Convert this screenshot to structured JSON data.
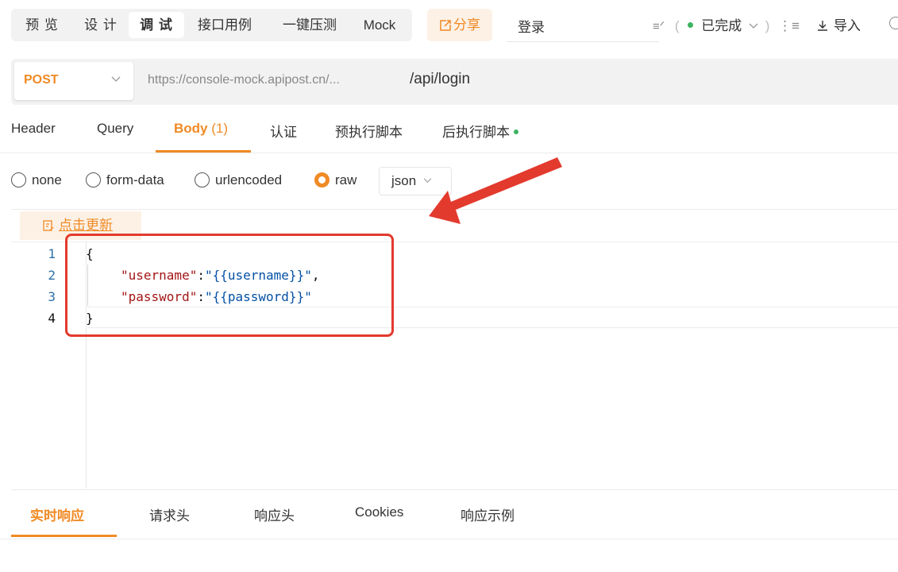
{
  "toolbar": {
    "mode_tabs": [
      "预 览",
      "设 计",
      "调 试",
      "接口用例",
      "一键压测",
      "Mock"
    ],
    "active_mode": "调 试",
    "share_label": "分享",
    "api_name": "登录",
    "status_label": "已完成",
    "import_label": "导入"
  },
  "request": {
    "method": "POST",
    "base_url": "https://console-mock.apipost.cn/...",
    "path": "/api/login"
  },
  "request_tabs": {
    "header": "Header",
    "query": "Query",
    "body": "Body",
    "body_count": "(1)",
    "auth": "认证",
    "pre_script": "预执行脚本",
    "post_script": "后执行脚本"
  },
  "body_type": {
    "options": [
      "none",
      "form-data",
      "urlencoded",
      "raw"
    ],
    "selected": "raw",
    "format": "json"
  },
  "editor": {
    "update_label": "点击更新",
    "line_numbers": [
      "1",
      "2",
      "3",
      "4"
    ],
    "lines": {
      "open": "{",
      "k1": "\"username\"",
      "v1": "\"{{username}}\"",
      "k2": "\"password\"",
      "v2": "\"{{password}}\"",
      "close": "}"
    }
  },
  "response_tabs": [
    "实时响应",
    "请求头",
    "响应头",
    "Cookies",
    "响应示例"
  ],
  "colors": {
    "accent": "#f08a24",
    "annotation": "#e33a2e",
    "status_green": "#3db360",
    "json_key": "#a31515",
    "json_value": "#0451a5"
  }
}
